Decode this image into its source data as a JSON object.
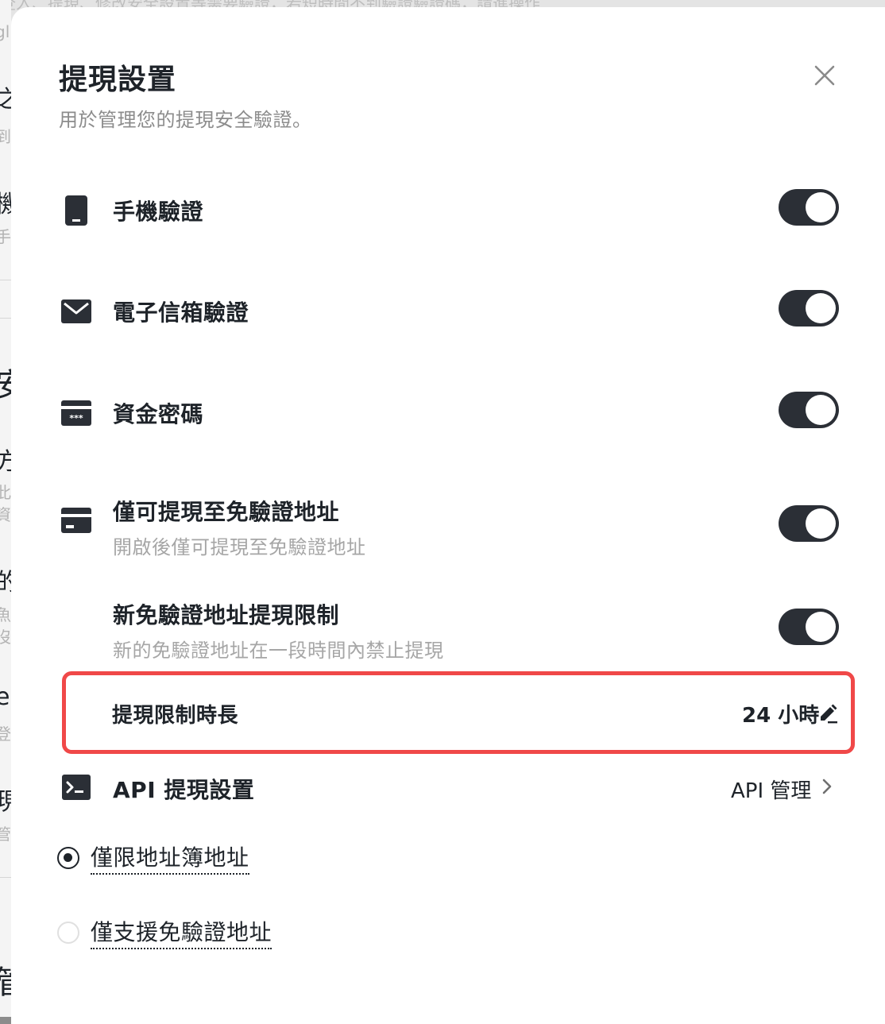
{
  "background": {
    "top_text": "登入、提現、修改安全設置等需要驗證，若短時間不到驗證驗證碼，請進操作",
    "left_fragments": [
      "gl",
      "之",
      "到",
      "機",
      "手",
      "安",
      "方",
      "此",
      "資",
      "的",
      "魚",
      "沒",
      "e",
      "登",
      "現",
      "管",
      "管"
    ]
  },
  "modal": {
    "title": "提現設置",
    "subtitle": "用於管理您的提現安全驗證。",
    "close_icon": "close-icon"
  },
  "settings": [
    {
      "label": "手機驗證",
      "icon": "phone-icon",
      "enabled": true
    },
    {
      "label": "電子信箱驗證",
      "icon": "envelope-icon",
      "enabled": true
    },
    {
      "label": "資金密碼",
      "icon": "password-card-icon",
      "enabled": true
    },
    {
      "label": "僅可提現至免驗證地址",
      "description": "開啟後僅可提現至免驗證地址",
      "icon": "card-icon",
      "enabled": true
    },
    {
      "label": "新免驗證地址提現限制",
      "description": "新的免驗證地址在一段時間內禁止提現",
      "enabled": true
    }
  ],
  "withdrawal_limit": {
    "label": "提現限制時長",
    "value": "24 小時",
    "icon": "edit-icon"
  },
  "api": {
    "label": "API 提現設置",
    "icon": "terminal-icon",
    "link_label": "API 管理",
    "link_icon": "chevron-right-icon"
  },
  "radio_options": [
    {
      "label": "僅限地址簿地址",
      "selected": true
    },
    {
      "label": "僅支援免驗證地址",
      "selected": false
    }
  ],
  "colors": {
    "toggle_on": "#2b2f36",
    "highlight_border": "#f04848",
    "text_primary": "#1e2329",
    "text_muted": "#a6a6a6"
  }
}
